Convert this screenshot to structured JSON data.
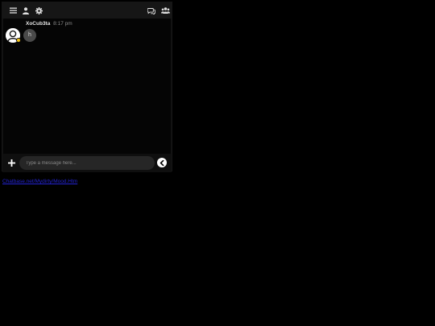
{
  "topbar": {
    "icons": [
      "menu-icon",
      "user-icon",
      "gear-icon",
      "chat-bubbles-icon",
      "users-icon"
    ]
  },
  "message": {
    "username": "XoCub3ta",
    "time": "8:17 pm",
    "text": "h",
    "presence_color": "#f5c518"
  },
  "composer": {
    "placeholder": "Type a message here...",
    "value": ""
  },
  "footer_link": {
    "text": "Chatbase.net/Mydirty/Mood.Htm"
  },
  "colors": {
    "background": "#000000",
    "panel": "#0b0b0b",
    "input": "#262626",
    "link": "#2424d6"
  }
}
